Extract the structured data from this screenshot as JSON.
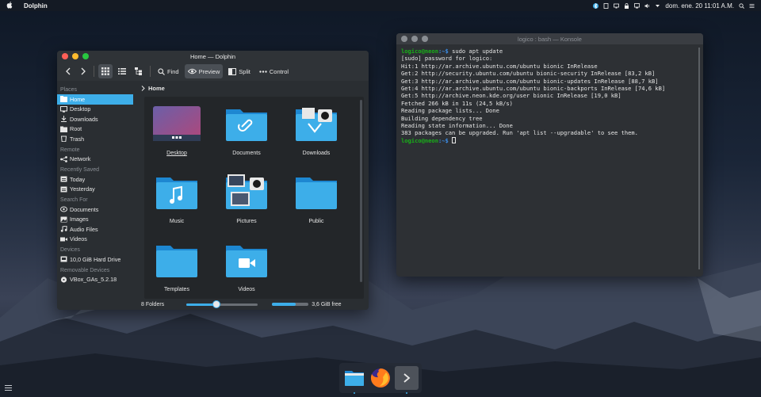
{
  "menubar": {
    "apple_glyph": "",
    "app_name": "Dolphin",
    "clock": "dom. ene. 20 11:01 A.M."
  },
  "dolphin": {
    "title": "Home — Dolphin",
    "toolbar": {
      "find": "Find",
      "preview": "Preview",
      "split": "Split",
      "control": "Control"
    },
    "breadcrumb": "Home",
    "places": {
      "title": "Places",
      "items": [
        "Home",
        "Desktop",
        "Downloads",
        "Root",
        "Trash"
      ]
    },
    "remote": {
      "title": "Remote",
      "items": [
        "Network"
      ]
    },
    "recent": {
      "title": "Recently Saved",
      "items": [
        "Today",
        "Yesterday"
      ]
    },
    "search": {
      "title": "Search For",
      "items": [
        "Documents",
        "Images",
        "Audio Files",
        "Videos"
      ]
    },
    "devices": {
      "title": "Devices",
      "items": [
        "10,0 GiB Hard Drive"
      ]
    },
    "removable": {
      "title": "Removable Devices",
      "items": [
        "VBox_GAs_5.2.18"
      ]
    },
    "folders": [
      "Desktop",
      "Documents",
      "Downloads",
      "Music",
      "Pictures",
      "Public",
      "Templates",
      "Videos"
    ],
    "status": {
      "count": "8 Folders",
      "free": "3,6 GiB free",
      "zoom_fraction": 0.42,
      "disk_used_fraction": 0.64
    }
  },
  "konsole": {
    "title": "logico : bash — Konsole",
    "user_host": "logico@neon",
    "path": ":~$",
    "command": " sudo apt update",
    "output": [
      "[sudo] password for logico:",
      "Hit:1 http://ar.archive.ubuntu.com/ubuntu bionic InRelease",
      "Get:2 http://security.ubuntu.com/ubuntu bionic-security InRelease [83,2 kB]",
      "Get:3 http://ar.archive.ubuntu.com/ubuntu bionic-updates InRelease [88,7 kB]",
      "Get:4 http://ar.archive.ubuntu.com/ubuntu bionic-backports InRelease [74,6 kB]",
      "Get:5 http://archive.neon.kde.org/user bionic InRelease [19,0 kB]",
      "Fetched 266 kB in 11s (24,5 kB/s)",
      "Reading package lists... Done",
      "Building dependency tree",
      "Reading state information... Done",
      "383 packages can be upgraded. Run 'apt list --upgradable' to see them."
    ]
  },
  "dock": {
    "items": [
      "folder-icon",
      "firefox-icon",
      "terminal-icon"
    ]
  },
  "colors": {
    "accent": "#3daee9",
    "folder_blue": "#3daee9",
    "prompt_user": "#18b218",
    "prompt_path": "#3b8eea"
  }
}
